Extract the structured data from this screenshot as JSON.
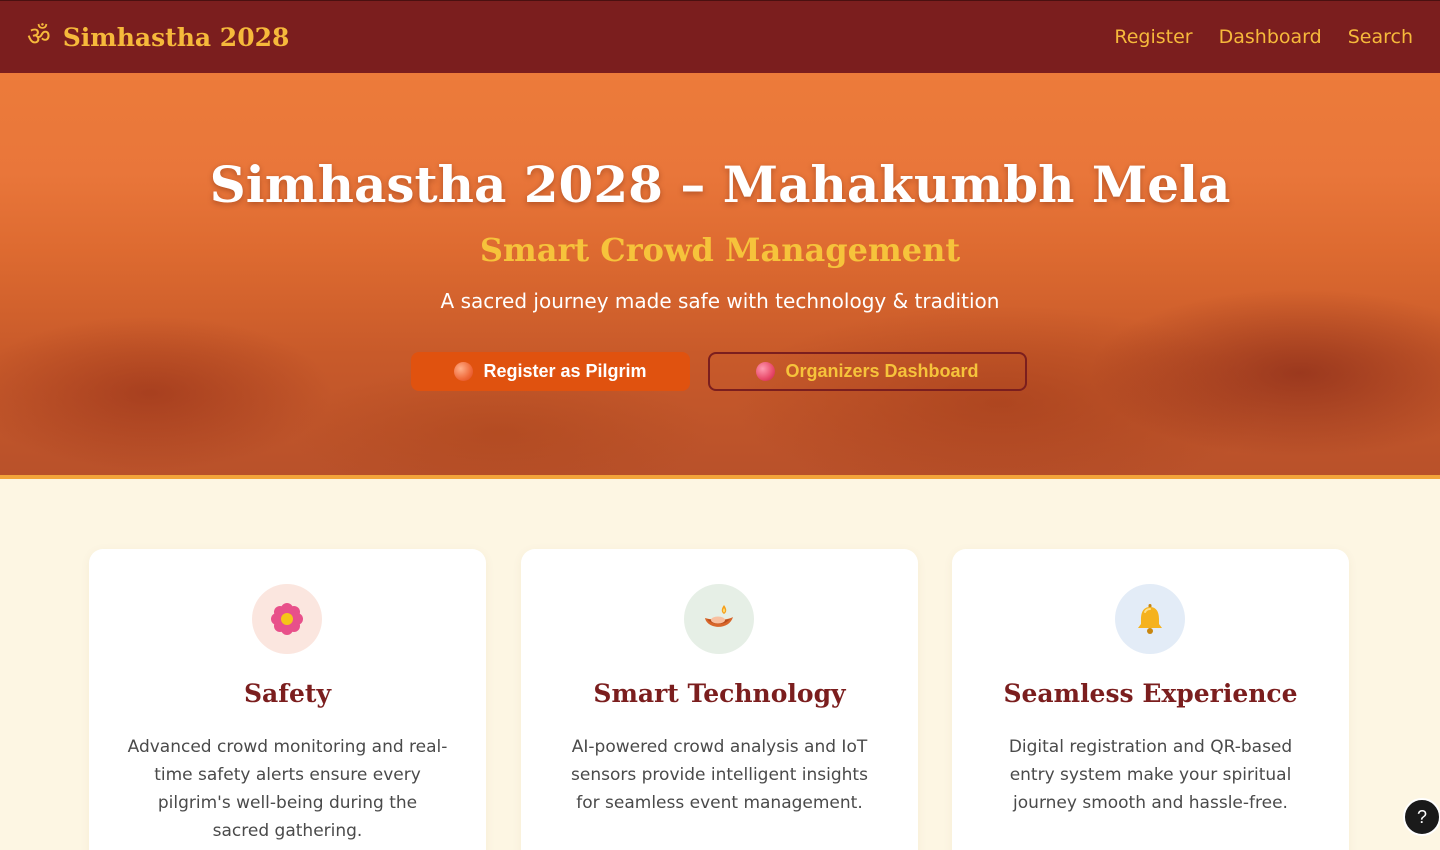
{
  "nav": {
    "brand_icon": "ॐ",
    "brand_name": "Simhastha 2028",
    "links": [
      {
        "label": "Register"
      },
      {
        "label": "Dashboard"
      },
      {
        "label": "Search"
      }
    ]
  },
  "hero": {
    "title": "Simhastha 2028 – Mahakumbh Mela",
    "subtitle": "Smart Crowd Management",
    "tagline": "A sacred journey made safe with technology & tradition",
    "primary_button": "Register as Pilgrim",
    "secondary_button": "Organizers Dashboard"
  },
  "features": [
    {
      "icon": "lotus-icon",
      "title": "Safety",
      "text": "Advanced crowd monitoring and real-time safety alerts ensure every pilgrim's well-being during the sacred gathering."
    },
    {
      "icon": "diya-lamp-icon",
      "title": "Smart Technology",
      "text": "AI-powered crowd analysis and IoT sensors provide intelligent insights for seamless event management."
    },
    {
      "icon": "bell-icon",
      "title": "Seamless Experience",
      "text": "Digital registration and QR-based entry system make your spiritual journey smooth and hassle-free."
    }
  ],
  "help": {
    "label": "?"
  },
  "colors": {
    "nav_bg": "#7b1e1e",
    "accent_gold": "#f6b93b",
    "hero_orange": "#e9763a",
    "primary_button": "#e0520f",
    "page_bg": "#fdf6e3",
    "card_title": "#7b1e1e"
  }
}
